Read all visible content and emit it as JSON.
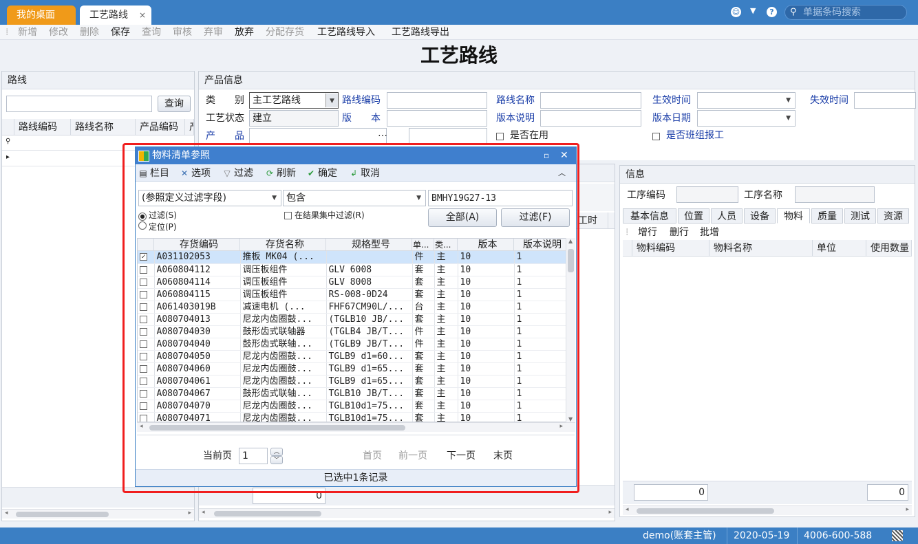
{
  "tabs": [
    {
      "label": "我的桌面"
    },
    {
      "label": "工艺路线",
      "close": "×"
    }
  ],
  "search": {
    "placeholder": "单据条码搜索"
  },
  "toolbar": {
    "add": "新增",
    "edit": "修改",
    "delete": "删除",
    "save": "保存",
    "query": "查询",
    "audit": "审核",
    "unaudit": "弃审",
    "discard": "放弃",
    "allocate": "分配存货",
    "import": "工艺路线导入",
    "export": "工艺路线导出"
  },
  "page_title": "工艺路线",
  "left": {
    "header": "路线",
    "query_button": "查询",
    "columns": [
      "路线编码",
      "路线名称",
      "产品编码",
      "产"
    ]
  },
  "product": {
    "header": "产品信息",
    "category_label": "类　　别",
    "category_value": "主工艺路线",
    "route_code_label": "路线编码",
    "route_name_label": "路线名称",
    "effective_time_label": "生效时间",
    "expire_time_label": "失效时间",
    "status_label": "工艺状态",
    "status_value": "建立",
    "version_label": "版　　本",
    "version_desc_label": "版本说明",
    "version_date_label": "版本日期",
    "product_label": "产　　品",
    "in_use_label": "是否在用",
    "team_report_label": "是否班组报工"
  },
  "mid": {
    "col_worktime": "工时",
    "total": "0"
  },
  "info": {
    "header": "信息",
    "op_code_label": "工序编码",
    "op_name_label": "工序名称",
    "tabs": [
      "基本信息",
      "位置",
      "人员",
      "设备",
      "物料",
      "质量",
      "测试",
      "资源"
    ],
    "active_tab": "物料",
    "actions": [
      "增行",
      "删行",
      "批增"
    ],
    "columns": [
      "物料编码",
      "物料名称",
      "单位",
      "使用数量"
    ],
    "total_left": "0",
    "total_right": "0"
  },
  "dialog": {
    "title": "物料清单参照",
    "toolbar": [
      {
        "icon": "columns-icon",
        "glyph": "▤",
        "label": "栏目"
      },
      {
        "icon": "options-icon",
        "glyph": "✕",
        "label": "选项"
      },
      {
        "icon": "filter-icon",
        "glyph": "▽",
        "label": "过滤"
      },
      {
        "icon": "refresh-icon",
        "glyph": "⟳",
        "label": "刷新"
      },
      {
        "icon": "confirm-icon",
        "glyph": "✔",
        "label": "确定"
      },
      {
        "icon": "cancel-icon",
        "glyph": "↲",
        "label": "取消"
      }
    ],
    "filter_field": "(参照定义过滤字段)",
    "filter_op": "包含",
    "filter_value": "BMHY19G27-13",
    "radio_filter": "过滤(S)",
    "radio_locate": "定位(P)",
    "in_result_filter": "在结果集中过滤(R)",
    "btn_all": "全部(A)",
    "btn_filter": "过滤(F)",
    "columns": [
      "",
      "存货编码",
      "存货名称",
      "规格型号",
      "单...",
      "类...",
      "版本",
      "版本说明"
    ],
    "rows": [
      {
        "checked": true,
        "code": "A031102053",
        "name": "推板 MK04 (...",
        "spec": "",
        "unit": "件",
        "type": "主",
        "ver": "10",
        "verdesc": "1"
      },
      {
        "checked": false,
        "code": "A060804112",
        "name": "调压板组件",
        "spec": "GLV 6008",
        "unit": "套",
        "type": "主",
        "ver": "10",
        "verdesc": "1"
      },
      {
        "checked": false,
        "code": "A060804114",
        "name": "调压板组件",
        "spec": "GLV 8008",
        "unit": "套",
        "type": "主",
        "ver": "10",
        "verdesc": "1"
      },
      {
        "checked": false,
        "code": "A060804115",
        "name": "调压板组件",
        "spec": "RS-008-0D24",
        "unit": "套",
        "type": "主",
        "ver": "10",
        "verdesc": "1"
      },
      {
        "checked": false,
        "code": "A061403019B",
        "name": "减速电机 (...",
        "spec": "FHF67CM90L/...",
        "unit": "台",
        "type": "主",
        "ver": "10",
        "verdesc": "1"
      },
      {
        "checked": false,
        "code": "A080704013",
        "name": "尼龙内齿圈鼓...",
        "spec": "(TGLB10 JB/...",
        "unit": "套",
        "type": "主",
        "ver": "10",
        "verdesc": "1"
      },
      {
        "checked": false,
        "code": "A080704030",
        "name": "鼓形齿式联轴器",
        "spec": "(TGLB4 JB/T...",
        "unit": "件",
        "type": "主",
        "ver": "10",
        "verdesc": "1"
      },
      {
        "checked": false,
        "code": "A080704040",
        "name": "鼓形齿式联轴...",
        "spec": "(TGLB9 JB/T...",
        "unit": "件",
        "type": "主",
        "ver": "10",
        "verdesc": "1"
      },
      {
        "checked": false,
        "code": "A080704050",
        "name": "尼龙内齿圈鼓...",
        "spec": "TGLB9 d1=60...",
        "unit": "套",
        "type": "主",
        "ver": "10",
        "verdesc": "1"
      },
      {
        "checked": false,
        "code": "A080704060",
        "name": "尼龙内齿圈鼓...",
        "spec": "TGLB9 d1=65...",
        "unit": "套",
        "type": "主",
        "ver": "10",
        "verdesc": "1"
      },
      {
        "checked": false,
        "code": "A080704061",
        "name": "尼龙内齿圈鼓...",
        "spec": "TGLB9 d1=65...",
        "unit": "套",
        "type": "主",
        "ver": "10",
        "verdesc": "1"
      },
      {
        "checked": false,
        "code": "A080704067",
        "name": "鼓形齿式联轴...",
        "spec": "TGLB10 JB/T...",
        "unit": "套",
        "type": "主",
        "ver": "10",
        "verdesc": "1"
      },
      {
        "checked": false,
        "code": "A080704070",
        "name": "尼龙内齿圈鼓...",
        "spec": "TGLB10d1=75...",
        "unit": "套",
        "type": "主",
        "ver": "10",
        "verdesc": "1"
      },
      {
        "checked": false,
        "code": "A080704071",
        "name": "尼龙内齿圈鼓...",
        "spec": "TGLB10d1=75...",
        "unit": "套",
        "type": "主",
        "ver": "10",
        "verdesc": "1"
      }
    ],
    "pager": {
      "current_label": "当前页",
      "current_value": "1",
      "first": "首页",
      "prev": "前一页",
      "next": "下一页",
      "last": "末页"
    },
    "footer": "已选中1条记录"
  },
  "status": {
    "user": "demo(账套主管)",
    "date": "2020-05-19",
    "phone": "4006-600-588"
  },
  "colors": {
    "brand_blue": "#3b7fc4",
    "home_tab": "#f09a19",
    "highlight_box": "#f01e1e",
    "selected_row": "#cfe4fb"
  }
}
